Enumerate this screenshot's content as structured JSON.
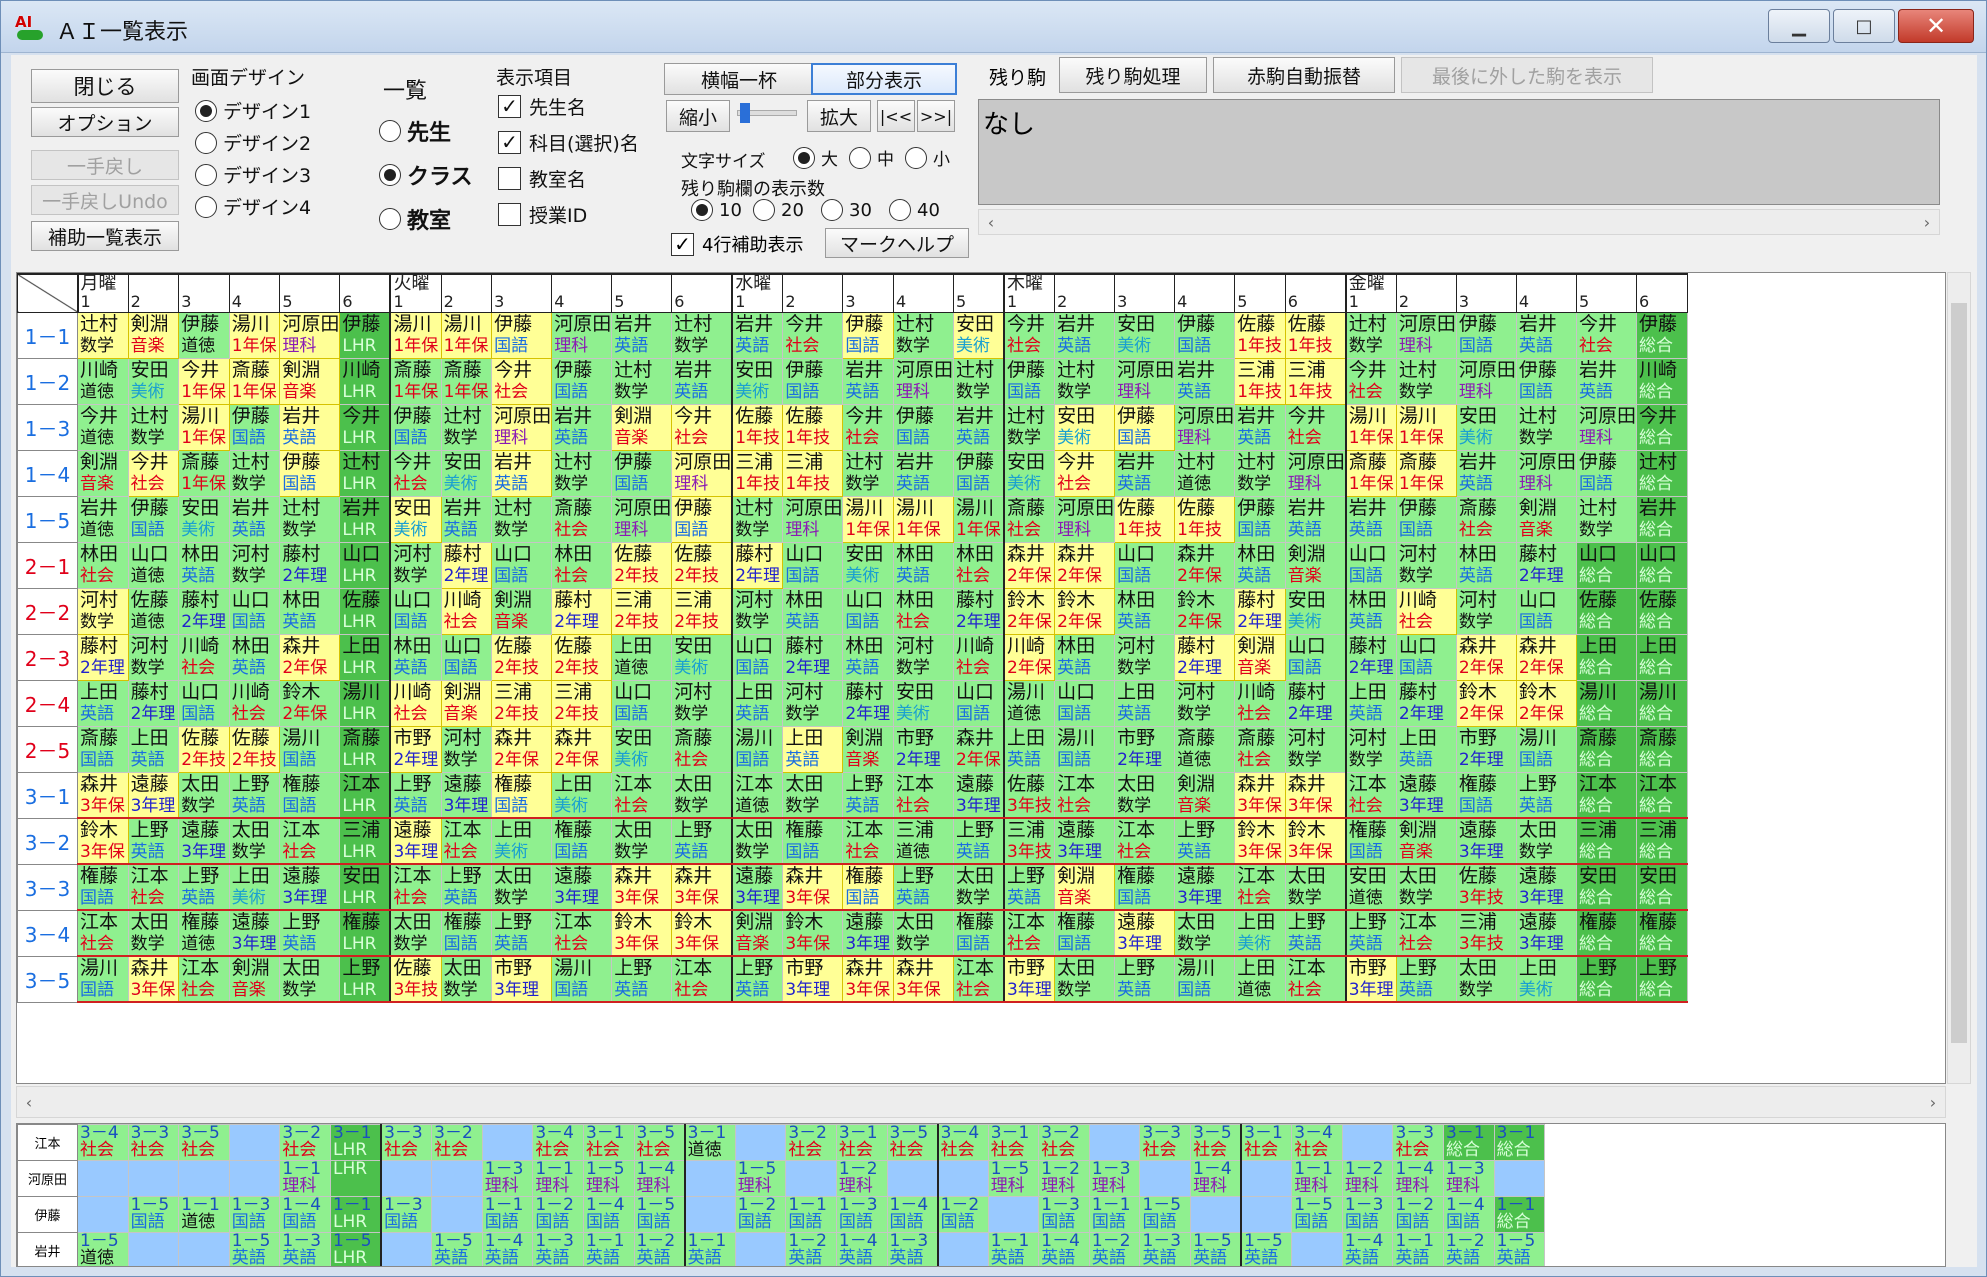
{
  "window": {
    "title": "ＡＩ一覧表示",
    "app_icon": "ai-app-icon",
    "minimize_icon": "minimize-icon",
    "maximize_icon": "maximize-icon",
    "close_icon": "close-icon"
  },
  "controls": {
    "close": "閉じる",
    "options": "オプション",
    "undo": "一手戻し",
    "undo_undo": "一手戻しUndo",
    "aux": "補助一覧表示",
    "design_title": "画面デザイン",
    "designs": [
      "デザイン1",
      "デザイン2",
      "デザイン3",
      "デザイン4"
    ],
    "list_title": "一覧",
    "list_opts": [
      "先生",
      "クラス",
      "教室"
    ],
    "items_title": "表示項目",
    "items": [
      "先生名",
      "科目(選択)名",
      "教室名",
      "授業ID"
    ],
    "width_full": "横幅一杯",
    "partial": "部分表示",
    "shrink": "縮小",
    "expand": "拡大",
    "prev": "|<<",
    "next": ">>|",
    "font_title": "文字サイズ",
    "font_opts": [
      "大",
      "中",
      "小"
    ],
    "count_title": "残り駒欄の表示数",
    "count_opts": [
      "10",
      "20",
      "30",
      "40"
    ],
    "aux4": "4行補助表示",
    "markhelp": "マークヘルプ",
    "remaining_label": "残り駒",
    "remaining_proc": "残り駒処理",
    "red_auto": "赤駒自動振替",
    "last_removed": "最後に外した駒を表示",
    "remaining_value": "なし"
  },
  "colors": {
    "green": "#8ff08f",
    "yellow": "#ffff96",
    "dark": "#4cc04c",
    "blue": "#99c9ff"
  },
  "days": [
    {
      "name": "月曜",
      "periods": 6
    },
    {
      "name": "火曜",
      "periods": 6
    },
    {
      "name": "水曜",
      "periods": 5
    },
    {
      "name": "木曜",
      "periods": 6
    },
    {
      "name": "金曜",
      "periods": 6
    }
  ],
  "classes": [
    "1－1",
    "1－2",
    "1－3",
    "1－4",
    "1－5",
    "2－1",
    "2－2",
    "2－3",
    "2－4",
    "2－5",
    "3－1",
    "3－2",
    "3－3",
    "3－4",
    "3－5"
  ],
  "teachers": [
    "江本",
    "河原田",
    "伊藤",
    "岩井"
  ],
  "grid": [
    [
      "辻村/数学/y",
      "剣淵/音楽/y",
      "伊藤/道徳/g",
      "湯川/1年保/y",
      "河原田/理科/y",
      "伊藤/LHR/d",
      "湯川/1年保/y",
      "湯川/1年保/y",
      "伊藤/国語/y",
      "河原田/理科/g",
      "岩井/英語/g",
      "辻村/数学/g",
      "岩井/英語/g",
      "今井/社会/g",
      "伊藤/国語/y",
      "辻村/数学/g",
      "安田/美術/y",
      "今井/社会/g",
      "岩井/英語/g",
      "安田/美術/g",
      "伊藤/国語/g",
      "佐藤/1年技/y",
      "佐藤/1年技/y",
      "辻村/数学/g",
      "河原田/理科/g",
      "伊藤/国語/g",
      "岩井/英語/g",
      "今井/社会/g",
      "伊藤/総合/d"
    ],
    [
      "川崎/道徳/g",
      "安田/美術/g",
      "今井/1年保/y",
      "斎藤/1年保/y",
      "剣淵/音楽/y",
      "川崎/LHR/d",
      "斎藤/1年保/g",
      "斎藤/1年保/g",
      "今井/社会/y",
      "伊藤/国語/g",
      "辻村/数学/g",
      "岩井/英語/g",
      "安田/美術/g",
      "伊藤/国語/g",
      "岩井/英語/g",
      "河原田/理科/g",
      "辻村/数学/g",
      "伊藤/国語/g",
      "辻村/数学/g",
      "河原田/理科/g",
      "岩井/英語/g",
      "三浦/1年技/y",
      "三浦/1年技/y",
      "今井/社会/g",
      "辻村/数学/g",
      "河原田/理科/g",
      "伊藤/国語/g",
      "岩井/英語/g",
      "川崎/総合/d"
    ],
    [
      "今井/道徳/g",
      "辻村/数学/g",
      "湯川/1年保/y",
      "伊藤/国語/g",
      "岩井/英語/y",
      "今井/LHR/d",
      "伊藤/国語/g",
      "辻村/数学/g",
      "河原田/理科/y",
      "岩井/英語/g",
      "剣淵/音楽/y",
      "今井/社会/y",
      "佐藤/1年技/y",
      "佐藤/1年技/y",
      "今井/社会/g",
      "伊藤/国語/g",
      "岩井/英語/g",
      "辻村/数学/g",
      "安田/美術/y",
      "伊藤/国語/y",
      "河原田/理科/g",
      "岩井/英語/g",
      "今井/社会/g",
      "湯川/1年保/y",
      "湯川/1年保/y",
      "安田/美術/g",
      "辻村/数学/g",
      "河原田/理科/g",
      "今井/総合/d"
    ],
    [
      "剣淵/音楽/g",
      "今井/社会/y",
      "斎藤/1年保/g",
      "辻村/数学/g",
      "伊藤/国語/y",
      "辻村/LHR/d",
      "今井/社会/g",
      "安田/美術/g",
      "岩井/英語/y",
      "辻村/数学/g",
      "伊藤/国語/g",
      "河原田/理科/y",
      "三浦/1年技/y",
      "三浦/1年技/y",
      "辻村/数学/g",
      "岩井/英語/g",
      "伊藤/国語/g",
      "安田/美術/g",
      "今井/社会/y",
      "岩井/英語/g",
      "辻村/道徳/g",
      "辻村/数学/g",
      "河原田/理科/g",
      "斎藤/1年保/y",
      "斎藤/1年保/y",
      "岩井/英語/g",
      "河原田/理科/g",
      "伊藤/国語/g",
      "辻村/総合/d"
    ],
    [
      "岩井/道徳/g",
      "伊藤/国語/g",
      "安田/美術/g",
      "岩井/英語/g",
      "辻村/数学/g",
      "岩井/LHR/d",
      "安田/美術/y",
      "岩井/英語/g",
      "辻村/数学/g",
      "斎藤/社会/g",
      "河原田/理科/g",
      "伊藤/国語/y",
      "辻村/数学/g",
      "河原田/理科/g",
      "湯川/1年保/y",
      "湯川/1年保/y",
      "湯川/1年保/g",
      "斎藤/社会/g",
      "河原田/理科/g",
      "佐藤/1年技/y",
      "佐藤/1年技/y",
      "伊藤/国語/g",
      "岩井/英語/g",
      "岩井/英語/g",
      "伊藤/国語/g",
      "斎藤/社会/g",
      "剣淵/音楽/g",
      "辻村/数学/g",
      "岩井/総合/d"
    ],
    [
      "林田/社会/g",
      "山口/道徳/g",
      "林田/英語/g",
      "河村/数学/g",
      "藤村/2年理/g",
      "山口/LHR/d",
      "河村/数学/g",
      "藤村/2年理/y",
      "山口/国語/g",
      "林田/社会/g",
      "佐藤/2年技/y",
      "佐藤/2年技/y",
      "藤村/2年理/y",
      "山口/国語/g",
      "安田/美術/g",
      "林田/英語/g",
      "林田/社会/g",
      "森井/2年保/y",
      "森井/2年保/y",
      "山口/国語/g",
      "森井/2年保/g",
      "林田/英語/g",
      "剣淵/音楽/g",
      "山口/国語/g",
      "河村/数学/g",
      "林田/英語/g",
      "藤村/2年理/g",
      "山口/総合/d",
      "山口/総合/d"
    ],
    [
      "河村/数学/y",
      "佐藤/道徳/g",
      "藤村/2年理/g",
      "山口/国語/g",
      "林田/英語/g",
      "佐藤/LHR/d",
      "山口/国語/g",
      "川崎/社会/y",
      "剣淵/音楽/g",
      "藤村/2年理/y",
      "三浦/2年技/y",
      "三浦/2年技/y",
      "河村/数学/g",
      "林田/英語/g",
      "山口/国語/g",
      "林田/社会/g",
      "藤村/2年理/g",
      "鈴木/2年保/y",
      "鈴木/2年保/y",
      "林田/英語/g",
      "鈴木/2年保/g",
      "藤村/2年理/y",
      "安田/美術/g",
      "林田/英語/g",
      "川崎/社会/y",
      "河村/数学/g",
      "山口/国語/g",
      "佐藤/総合/d",
      "佐藤/総合/d"
    ],
    [
      "藤村/2年理/y",
      "河村/数学/g",
      "川崎/社会/g",
      "林田/英語/g",
      "森井/2年保/y",
      "上田/LHR/d",
      "林田/英語/g",
      "山口/国語/g",
      "佐藤/2年技/y",
      "佐藤/2年技/y",
      "上田/道徳/g",
      "安田/美術/g",
      "山口/国語/g",
      "藤村/2年理/g",
      "林田/英語/g",
      "河村/数学/g",
      "川崎/社会/g",
      "川崎/2年保/y",
      "林田/英語/g",
      "河村/数学/g",
      "藤村/2年理/y",
      "剣淵/音楽/y",
      "山口/国語/g",
      "藤村/2年理/g",
      "山口/国語/g",
      "森井/2年保/y",
      "森井/2年保/y",
      "上田/総合/d",
      "上田/総合/d"
    ],
    [
      "上田/英語/g",
      "藤村/2年理/g",
      "山口/国語/g",
      "川崎/社会/g",
      "鈴木/2年保/g",
      "湯川/LHR/d",
      "川崎/社会/y",
      "剣淵/音楽/y",
      "三浦/2年技/y",
      "三浦/2年技/y",
      "山口/国語/g",
      "河村/数学/g",
      "上田/英語/g",
      "河村/数学/g",
      "藤村/2年理/g",
      "安田/美術/g",
      "山口/国語/g",
      "湯川/道徳/g",
      "山口/国語/g",
      "上田/英語/g",
      "河村/数学/g",
      "川崎/社会/g",
      "藤村/2年理/g",
      "上田/英語/g",
      "藤村/2年理/g",
      "鈴木/2年保/y",
      "鈴木/2年保/y",
      "湯川/総合/d",
      "湯川/総合/d"
    ],
    [
      "斎藤/国語/g",
      "上田/英語/g",
      "佐藤/2年技/y",
      "佐藤/2年技/y",
      "湯川/国語/g",
      "斎藤/LHR/d",
      "市野/2年理/y",
      "河村/数学/g",
      "森井/2年保/y",
      "森井/2年保/y",
      "安田/美術/g",
      "斎藤/社会/g",
      "湯川/国語/g",
      "上田/英語/y",
      "剣淵/音楽/g",
      "市野/2年理/g",
      "森井/2年保/g",
      "上田/英語/g",
      "湯川/国語/g",
      "市野/2年理/g",
      "斎藤/道徳/g",
      "斎藤/社会/g",
      "河村/数学/g",
      "河村/数学/g",
      "上田/英語/g",
      "市野/2年理/g",
      "湯川/国語/g",
      "斎藤/総合/d",
      "斎藤/総合/d"
    ],
    [
      "森井/3年保/y",
      "遠藤/3年理/y",
      "太田/数学/g",
      "上野/英語/g",
      "権藤/国語/g",
      "江本/LHR/d",
      "上野/英語/g",
      "遠藤/3年理/g",
      "権藤/国語/y",
      "上田/美術/g",
      "江本/社会/g",
      "太田/数学/g",
      "江本/道徳/g",
      "太田/数学/g",
      "上野/英語/g",
      "江本/社会/g",
      "遠藤/3年理/g",
      "佐藤/3年技/g",
      "江本/社会/g",
      "太田/数学/g",
      "剣淵/音楽/g",
      "森井/3年保/y",
      "森井/3年保/y",
      "江本/社会/g",
      "遠藤/3年理/g",
      "権藤/国語/g",
      "上野/英語/g",
      "江本/総合/d",
      "江本/総合/d"
    ],
    [
      "鈴木/3年保/y",
      "上野/英語/g",
      "遠藤/3年理/g",
      "太田/数学/g",
      "江本/社会/g",
      "三浦/LHR/d",
      "遠藤/3年理/y",
      "江本/社会/g",
      "上田/美術/g",
      "権藤/国語/g",
      "太田/数学/g",
      "上野/英語/g",
      "太田/数学/g",
      "権藤/国語/g",
      "江本/社会/g",
      "三浦/道徳/g",
      "上野/英語/g",
      "三浦/3年技/g",
      "遠藤/3年理/g",
      "江本/社会/g",
      "上野/英語/g",
      "鈴木/3年保/y",
      "鈴木/3年保/y",
      "権藤/国語/g",
      "剣淵/音楽/g",
      "遠藤/3年理/g",
      "太田/数学/g",
      "三浦/総合/d",
      "三浦/総合/d"
    ],
    [
      "権藤/国語/g",
      "江本/社会/g",
      "上野/英語/g",
      "上田/美術/g",
      "遠藤/3年理/g",
      "安田/LHR/d",
      "江本/社会/g",
      "上野/英語/g",
      "太田/数学/g",
      "遠藤/3年理/g",
      "森井/3年保/y",
      "森井/3年保/y",
      "遠藤/3年理/g",
      "森井/3年保/y",
      "権藤/国語/y",
      "上野/英語/g",
      "太田/数学/g",
      "上野/英語/g",
      "剣淵/音楽/y",
      "権藤/国語/g",
      "遠藤/3年理/g",
      "江本/社会/g",
      "太田/数学/g",
      "安田/道徳/g",
      "太田/数学/g",
      "佐藤/3年技/g",
      "遠藤/3年理/g",
      "安田/総合/d",
      "安田/総合/d"
    ],
    [
      "江本/社会/g",
      "太田/数学/g",
      "権藤/道徳/g",
      "遠藤/3年理/g",
      "上野/英語/g",
      "権藤/LHR/d",
      "太田/数学/g",
      "権藤/国語/g",
      "上野/英語/g",
      "江本/社会/g",
      "鈴木/3年保/y",
      "鈴木/3年保/y",
      "剣淵/音楽/g",
      "鈴木/3年保/g",
      "遠藤/3年理/g",
      "太田/数学/g",
      "権藤/国語/g",
      "江本/社会/g",
      "権藤/国語/g",
      "遠藤/3年理/y",
      "太田/数学/g",
      "上田/美術/g",
      "上野/英語/g",
      "上野/英語/g",
      "江本/社会/g",
      "三浦/3年技/g",
      "遠藤/3年理/g",
      "権藤/総合/d",
      "権藤/総合/d"
    ],
    [
      "湯川/国語/g",
      "森井/3年保/y",
      "江本/社会/g",
      "剣淵/音楽/g",
      "太田/数学/g",
      "上野/LHR/d",
      "佐藤/3年技/y",
      "太田/数学/g",
      "市野/3年理/y",
      "湯川/国語/g",
      "上野/英語/g",
      "江本/社会/g",
      "上野/英語/g",
      "市野/3年理/y",
      "森井/3年保/y",
      "森井/3年保/y",
      "江本/社会/g",
      "市野/3年理/y",
      "太田/数学/g",
      "上野/英語/g",
      "湯川/国語/g",
      "上田/道徳/g",
      "江本/社会/g",
      "市野/3年理/y",
      "上野/英語/g",
      "太田/数学/g",
      "上田/美術/g",
      "上野/総合/d",
      "上野/総合/d"
    ]
  ],
  "bottom": [
    [
      "3－4/社会/g",
      "3－3/社会/g",
      "3－5/社会/g",
      "/ /b",
      "3－2/社会/g",
      "3－1/LHR/d",
      "3－3/社会/g",
      "3－2/社会/g",
      "/ /b",
      "3－4/社会/g",
      "3－1/社会/g",
      "3－5/社会/g",
      "3－1/道徳/g",
      "/ /b",
      "3－2/社会/g",
      "3－1/社会/g",
      "3－5/社会/g",
      "3－4/社会/g",
      "3－1/社会/g",
      "3－2/社会/g",
      "/ /b",
      "3－3/社会/g",
      "3－5/社会/g",
      "3－1/社会/g",
      "3－4/社会/g",
      "/ /b",
      "3－3/社会/g",
      "3－1/総合/d",
      "3－1/総合/d"
    ],
    [
      "/ /b",
      "/ /b",
      "/ /b",
      "/ /b",
      "1－1/理科/g",
      "/LHR/d",
      "/ /b",
      "/ /b",
      "1－3/理科/g",
      "1－1/理科/g",
      "1－5/理科/g",
      "1－4/理科/g",
      "/ /b",
      "1－5/理科/g",
      "/ /b",
      "1－2/理科/g",
      "/ /b",
      "/ /b",
      "1－5/理科/g",
      "1－2/理科/g",
      "1－3/理科/g",
      "/ /b",
      "1－4/理科/g",
      "/ /b",
      "1－1/理科/g",
      "1－2/理科/g",
      "1－4/理科/g",
      "1－3/理科/g",
      "/ /b"
    ],
    [
      "/ /b",
      "1－5/国語/g",
      "1－1/道徳/g",
      "1－3/国語/g",
      "1－4/国語/g",
      "1－1/LHR/d",
      "1－3/国語/g",
      "/ /b",
      "1－1/国語/g",
      "1－2/国語/g",
      "1－4/国語/g",
      "1－5/国語/g",
      "/ /b",
      "1－2/国語/g",
      "1－1/国語/g",
      "1－3/国語/g",
      "1－4/国語/g",
      "1－2/国語/g",
      "/ /b",
      "1－3/国語/g",
      "1－1/国語/g",
      "1－5/国語/g",
      "/ /b",
      "/ /b",
      "1－5/国語/g",
      "1－3/国語/g",
      "1－2/国語/g",
      "1－4/国語/g",
      "1－1/総合/d"
    ],
    [
      "1－5/道徳/g",
      "/ /b",
      "/ /b",
      "1－5/英語/g",
      "1－3/英語/g",
      "1－5/LHR/d",
      "/ /b",
      "1－5/英語/g",
      "1－4/英語/g",
      "1－3/英語/g",
      "1－1/英語/g",
      "1－2/英語/g",
      "1－1/英語/g",
      "/ /b",
      "1－2/英語/g",
      "1－4/英語/g",
      "1－3/英語/g",
      "/ /b",
      "1－1/英語/g",
      "1－4/英語/g",
      "1－2/英語/g",
      "1－3/英語/g",
      "1－5/英語/g",
      "1－5/英語/g",
      "/ /b",
      "1－4/英語/g",
      "1－1/英語/g",
      "1－2/英語/g",
      "1－5/英語/g"
    ]
  ]
}
